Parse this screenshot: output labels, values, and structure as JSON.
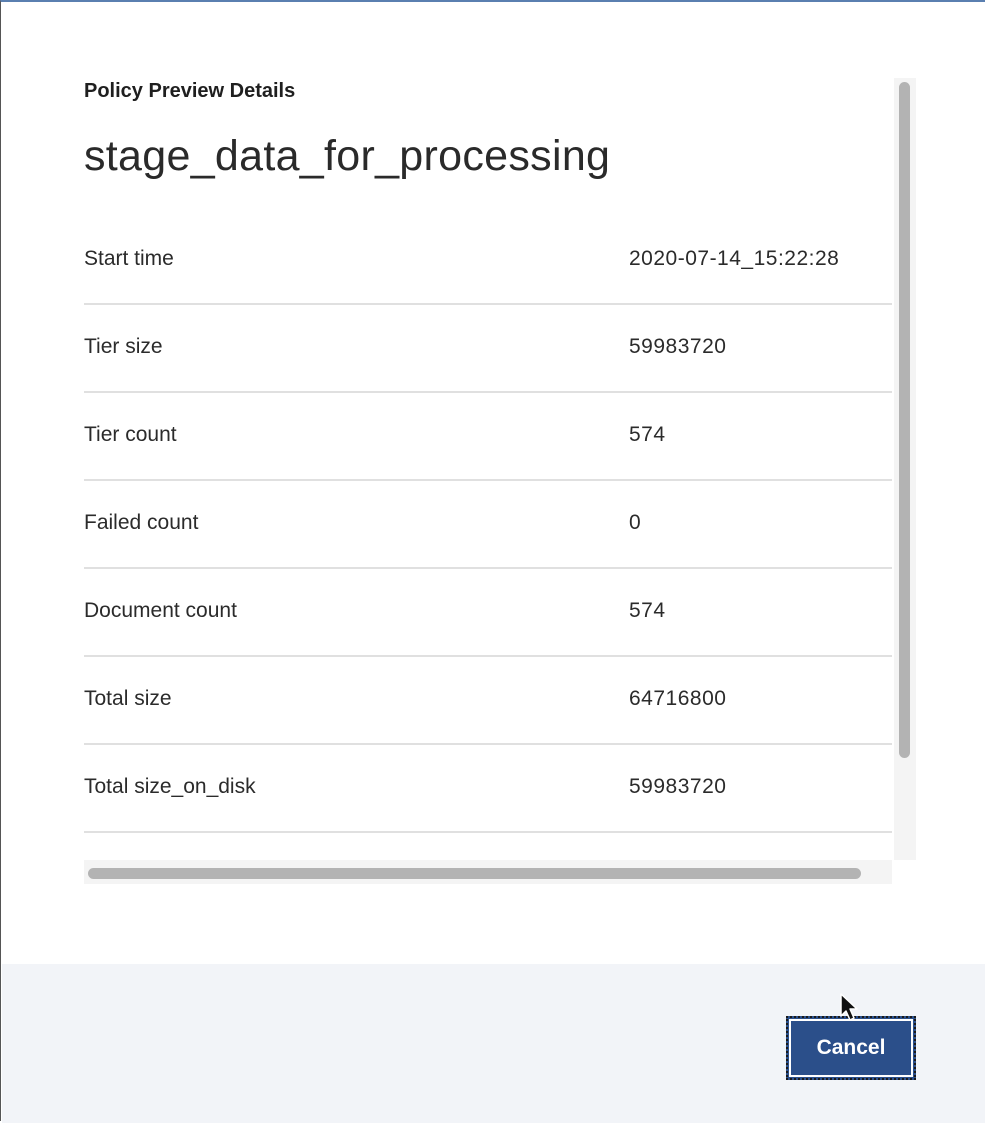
{
  "dialog": {
    "eyebrow": "Policy Preview Details",
    "title": "stage_data_for_processing"
  },
  "details": [
    {
      "label": "Start time",
      "value": "2020-07-14_15:22:28"
    },
    {
      "label": "Tier size",
      "value": "59983720"
    },
    {
      "label": "Tier count",
      "value": "574"
    },
    {
      "label": "Failed count",
      "value": "0"
    },
    {
      "label": "Document count",
      "value": "574"
    },
    {
      "label": "Total size",
      "value": "64716800"
    },
    {
      "label": "Total size_on_disk",
      "value": "59983720"
    }
  ],
  "footer": {
    "cancel_label": "Cancel"
  },
  "icons": {
    "cursor": "mouse-pointer-icon"
  }
}
